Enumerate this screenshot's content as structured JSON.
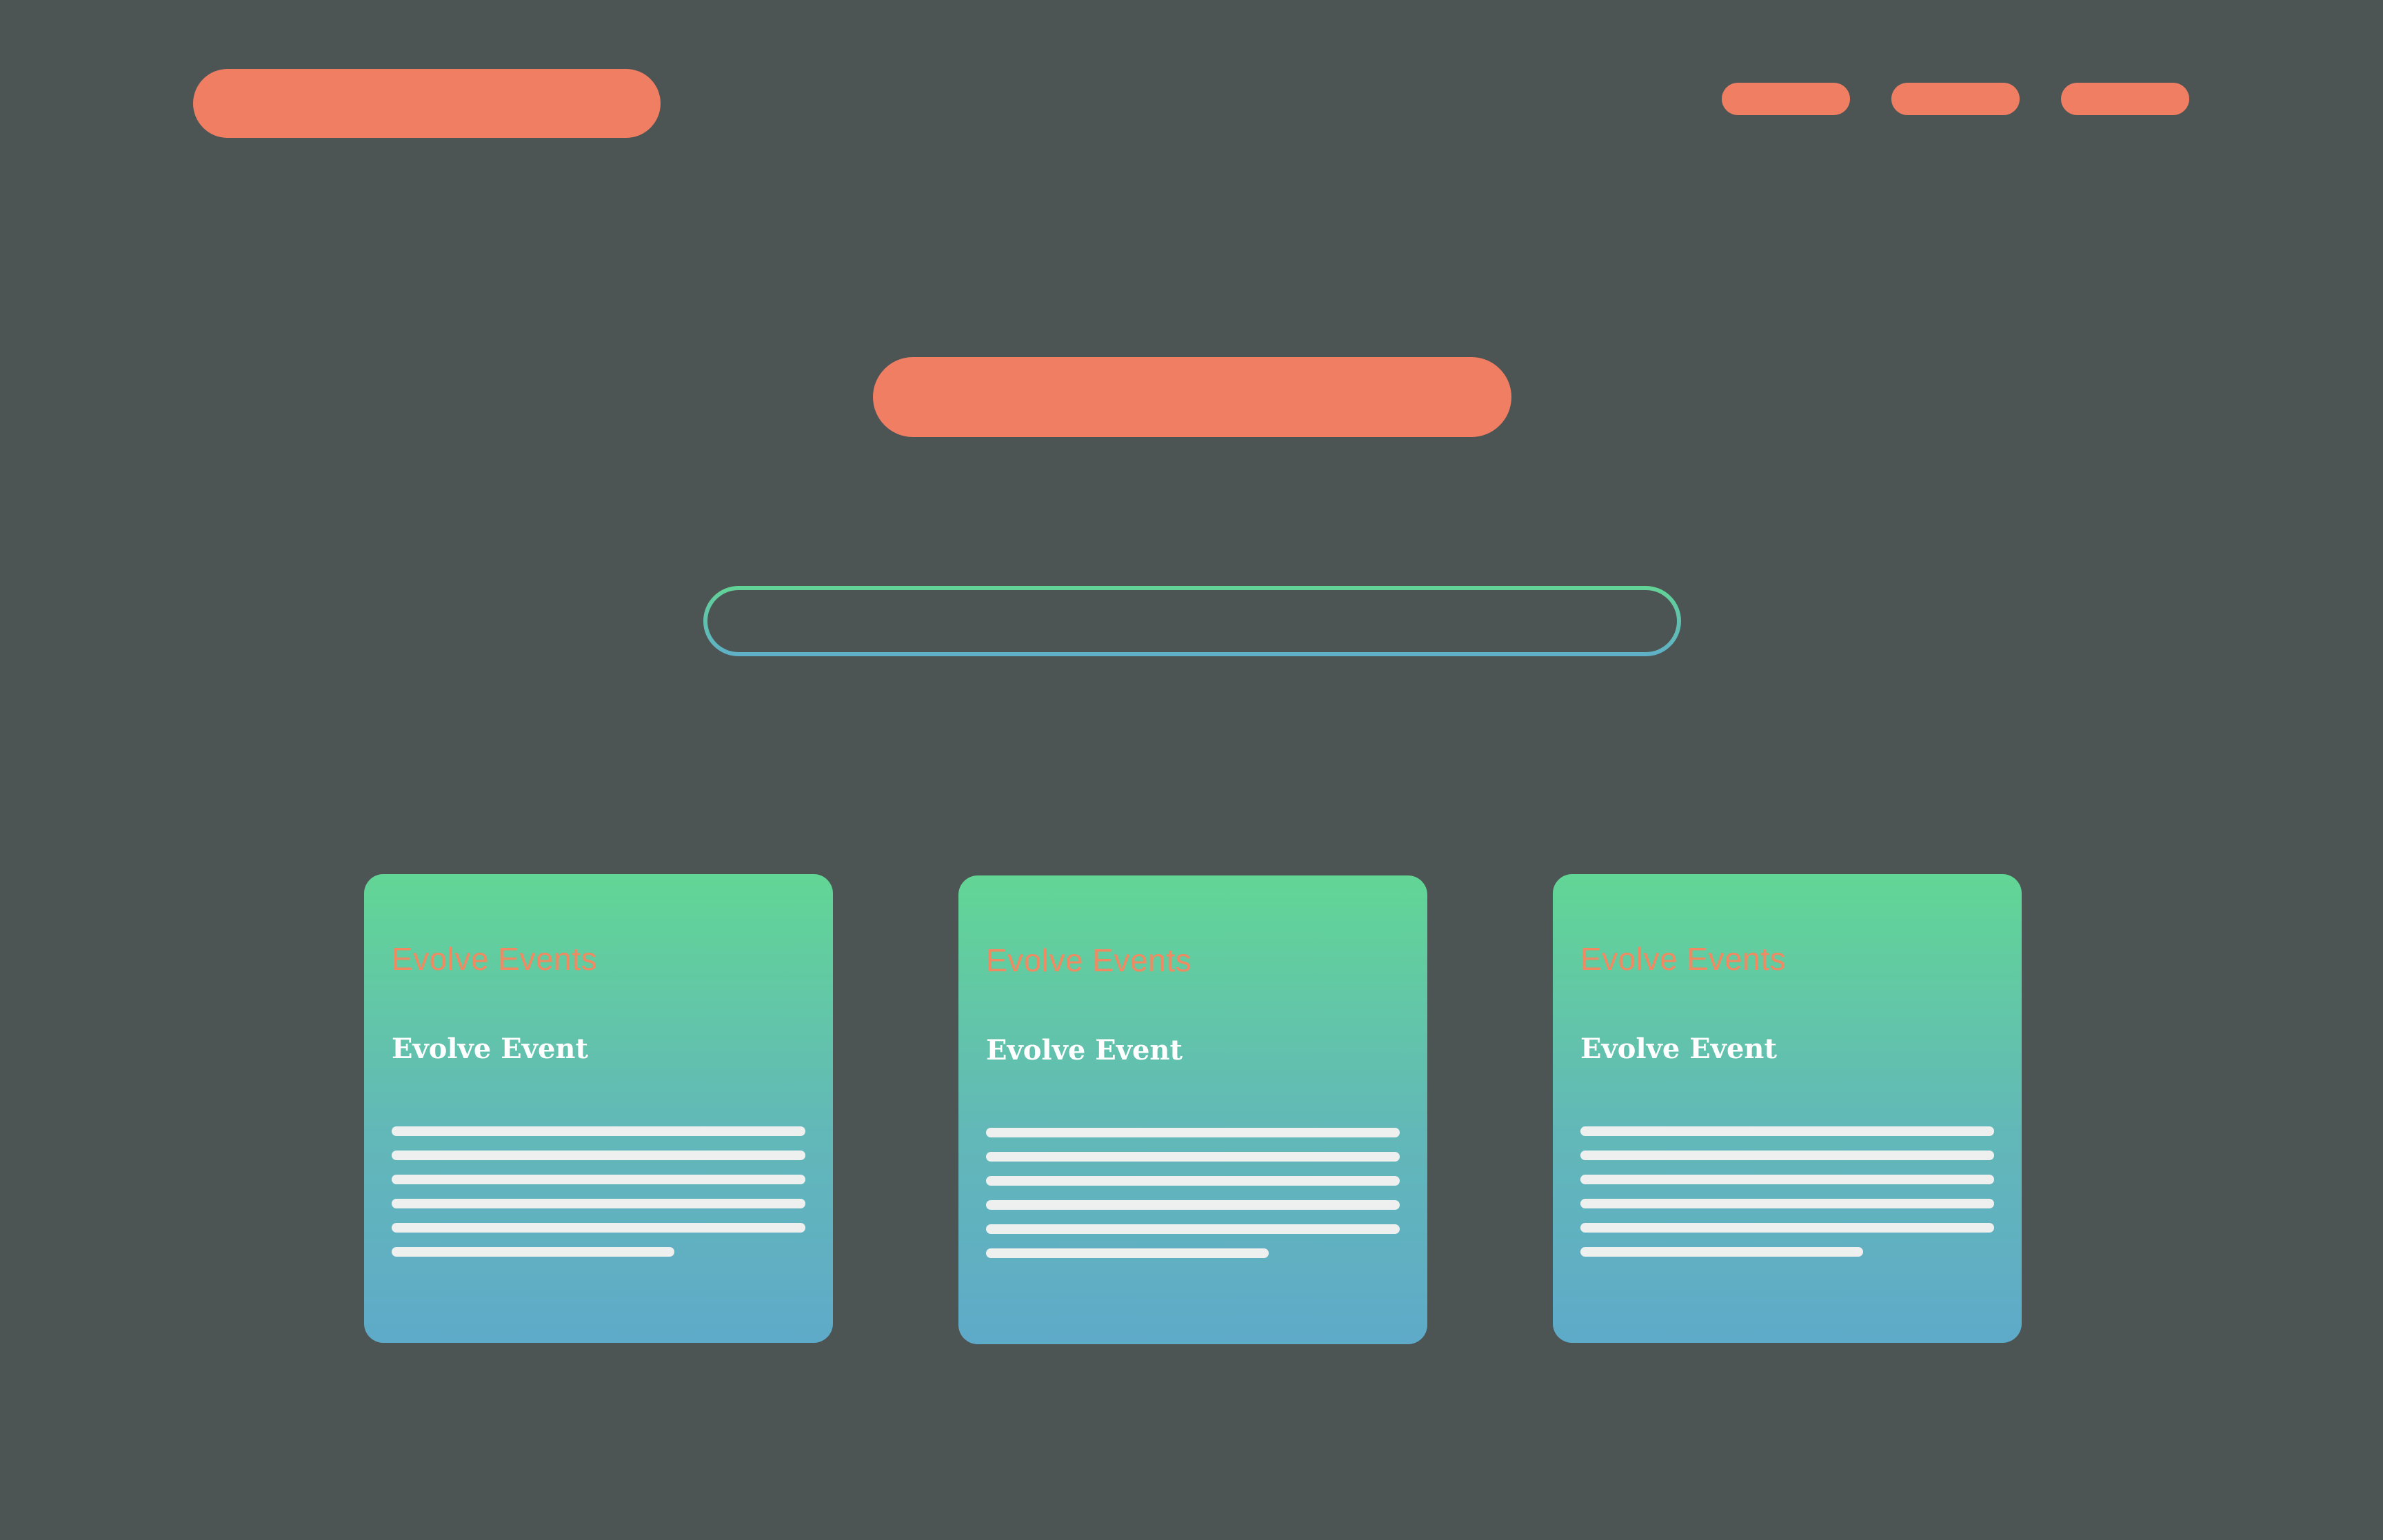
{
  "header": {
    "logo_placeholder": "logo-bar",
    "nav_items": [
      "nav-item-1",
      "nav-item-2",
      "nav-item-3"
    ]
  },
  "hero": {
    "title_placeholder": "hero-title-bar"
  },
  "search": {
    "value": "",
    "placeholder": ""
  },
  "cards": [
    {
      "eyebrow": "Evolve Events",
      "title": "Evolve Event"
    },
    {
      "eyebrow": "Evolve Events",
      "title": "Evolve Event"
    },
    {
      "eyebrow": "Evolve Events",
      "title": "Evolve Event"
    }
  ],
  "colors": {
    "background": "#4c5454",
    "accent": "#ef7e63",
    "card_gradient_top": "#62d695",
    "card_gradient_bottom": "#5eaac9",
    "text_lines": "#eef0ef"
  }
}
